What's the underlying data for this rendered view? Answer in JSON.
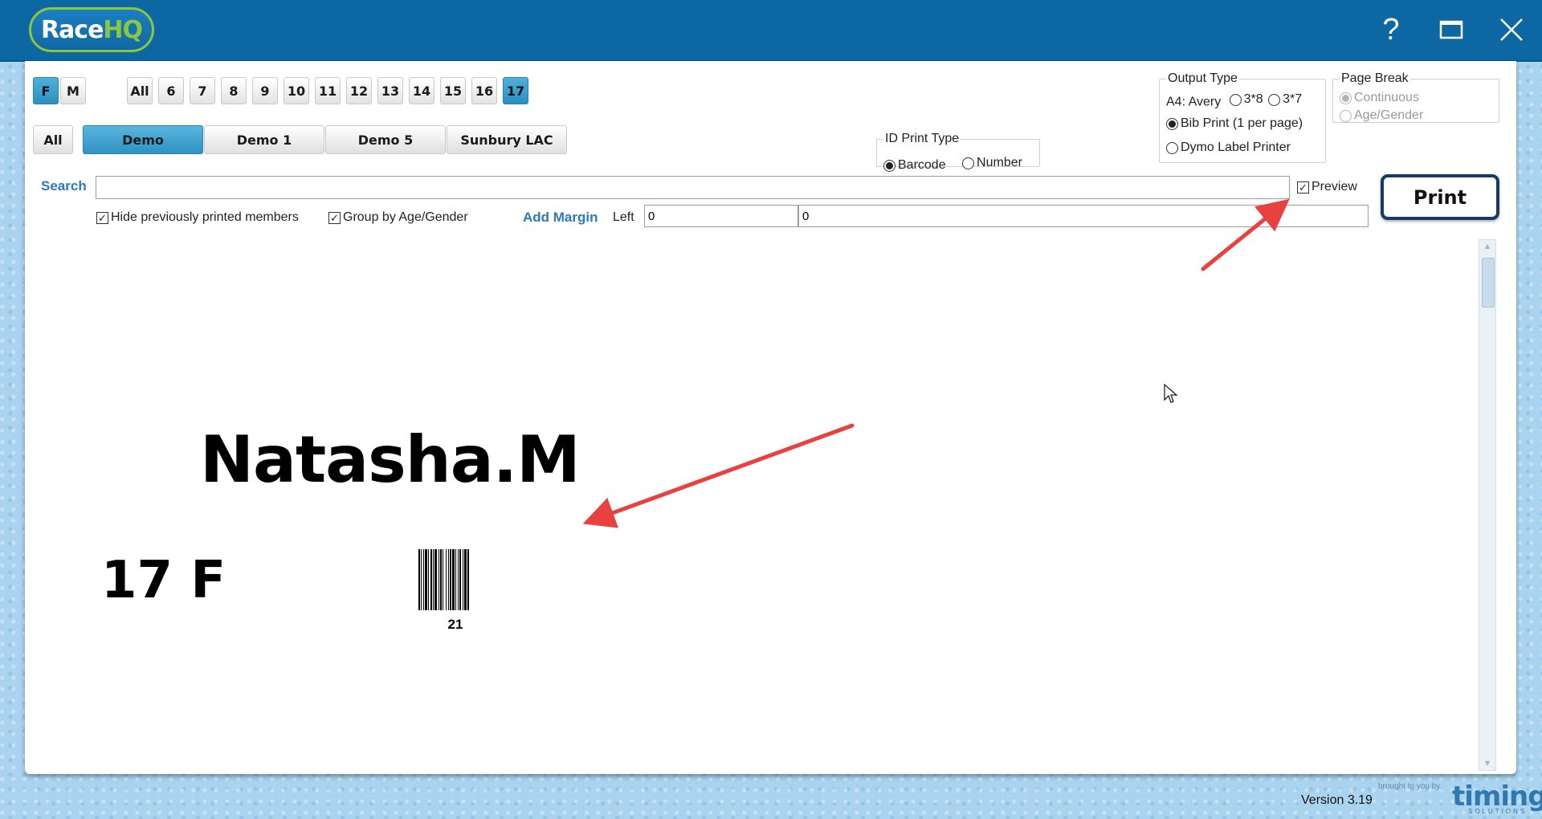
{
  "app": {
    "logo_race": "Race",
    "logo_hq": "HQ"
  },
  "window_controls": {
    "help": "?",
    "maximize": "☐",
    "close": "✕"
  },
  "gender_filters": [
    {
      "label": "F",
      "active": true
    },
    {
      "label": "M",
      "active": false
    }
  ],
  "age_filters": [
    {
      "label": "All",
      "active": false
    },
    {
      "label": "6",
      "active": false
    },
    {
      "label": "7",
      "active": false
    },
    {
      "label": "8",
      "active": false
    },
    {
      "label": "9",
      "active": false
    },
    {
      "label": "10",
      "active": false
    },
    {
      "label": "11",
      "active": false
    },
    {
      "label": "12",
      "active": false
    },
    {
      "label": "13",
      "active": false
    },
    {
      "label": "14",
      "active": false
    },
    {
      "label": "15",
      "active": false
    },
    {
      "label": "16",
      "active": false
    },
    {
      "label": "17",
      "active": true
    }
  ],
  "club_tabs": [
    {
      "label": "All",
      "active": false
    },
    {
      "label": "Demo",
      "active": true
    },
    {
      "label": "Demo 1",
      "active": false
    },
    {
      "label": "Demo 5",
      "active": false
    },
    {
      "label": "Sunbury LAC",
      "active": false
    }
  ],
  "id_print_type": {
    "legend": "ID Print Type",
    "options": [
      {
        "label": "Barcode",
        "selected": true
      },
      {
        "label": "Number",
        "selected": false
      }
    ]
  },
  "output_type": {
    "legend": "Output Type",
    "a4_label": "A4: Avery",
    "avery_options": [
      {
        "label": "3*8",
        "selected": false
      },
      {
        "label": "3*7",
        "selected": false
      }
    ],
    "bib_print": {
      "label": "Bib Print (1 per page)",
      "selected": true
    },
    "dymo": {
      "label": "Dymo Label Printer",
      "selected": false
    }
  },
  "page_break": {
    "legend": "Page Break",
    "options": [
      {
        "label": "Continuous",
        "selected": true
      },
      {
        "label": "Age/Gender",
        "selected": false
      }
    ]
  },
  "search": {
    "label": "Search",
    "value": ""
  },
  "preview": {
    "label": "Preview",
    "checked": true
  },
  "print_button": "Print",
  "options": {
    "hide_printed": {
      "label": "Hide previously printed members",
      "checked": true
    },
    "group_by": {
      "label": "Group by Age/Gender",
      "checked": true
    }
  },
  "margin": {
    "label": "Add Margin",
    "left_label": "Left",
    "left_value": "0",
    "top_value": "0"
  },
  "bib": {
    "name": "Natasha.M",
    "age_gender": "17 F",
    "barcode_number": "21"
  },
  "footer": {
    "version": "Version 3.19",
    "brand_small": "brought to you by",
    "brand": "timing",
    "brand_sub": "SOLUTIONS"
  },
  "colors": {
    "titlebar": "#0d67a3",
    "accent": "#2b8fc0",
    "annotation_arrow": "#e8413f",
    "logo_green": "#8cc63f"
  }
}
